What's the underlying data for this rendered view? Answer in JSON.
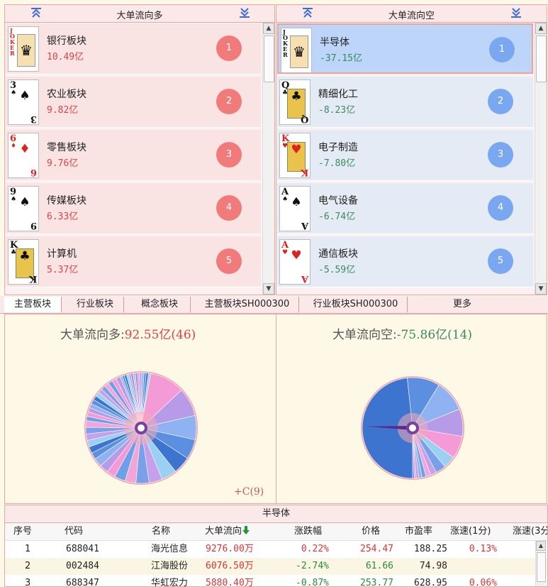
{
  "left_panel": {
    "title": "大单流向多",
    "items": [
      {
        "rank": "1",
        "name": "银行板块",
        "value": "10.49亿",
        "card": {
          "rank": "JOKER",
          "suit": "🃏",
          "color": "#d22",
          "face": true
        }
      },
      {
        "rank": "2",
        "name": "农业板块",
        "value": "9.82亿",
        "card": {
          "rank": "3",
          "suit": "♠",
          "color": "#111",
          "face": false
        }
      },
      {
        "rank": "3",
        "name": "零售板块",
        "value": "9.76亿",
        "card": {
          "rank": "6",
          "suit": "♦",
          "color": "#d22",
          "face": false
        }
      },
      {
        "rank": "4",
        "name": "传媒板块",
        "value": "6.33亿",
        "card": {
          "rank": "9",
          "suit": "♠",
          "color": "#111",
          "face": false
        }
      },
      {
        "rank": "5",
        "name": "计算机",
        "value": "5.37亿",
        "card": {
          "rank": "K",
          "suit": "♣",
          "color": "#111",
          "face": true
        }
      }
    ]
  },
  "right_panel": {
    "title": "大单流向空",
    "items": [
      {
        "rank": "1",
        "name": "半导体",
        "value": "-37.15亿",
        "card": {
          "rank": "JOKER",
          "suit": "🃏",
          "color": "#111",
          "face": true
        },
        "selected": true
      },
      {
        "rank": "2",
        "name": "精细化工",
        "value": "-8.23亿",
        "card": {
          "rank": "Q",
          "suit": "♣",
          "color": "#111",
          "face": true
        }
      },
      {
        "rank": "3",
        "name": "电子制造",
        "value": "-7.80亿",
        "card": {
          "rank": "K",
          "suit": "♥",
          "color": "#d22",
          "face": true
        }
      },
      {
        "rank": "4",
        "name": "电气设备",
        "value": "-6.74亿",
        "card": {
          "rank": "A",
          "suit": "♠",
          "color": "#111",
          "face": false
        }
      },
      {
        "rank": "5",
        "name": "通信板块",
        "value": "-5.59亿",
        "card": {
          "rank": "A",
          "suit": "♥",
          "color": "#d22",
          "face": false
        }
      }
    ]
  },
  "tabs": [
    "主营板块",
    "行业板块",
    "概念板块",
    "主营板块SH000300",
    "行业板块SH000300",
    "更多"
  ],
  "pies": {
    "left_label": "大单流向多:",
    "left_value": "92.55亿(46)",
    "right_label": "大单流向空:",
    "right_value": "-75.86亿(14)",
    "corner_note": "+C(9)"
  },
  "table": {
    "caption": "半导体",
    "headers": [
      "序号",
      "代码",
      "名称",
      "大单流向",
      "涨跌幅",
      "价格",
      "市盈率",
      "涨速(1分)",
      "涨速(3分"
    ],
    "rows": [
      [
        "1",
        "688041",
        "海光信息",
        "9276.00万",
        "0.22%",
        "254.47",
        "188.25",
        "0.13%",
        ""
      ],
      [
        "2",
        "002484",
        "江海股份",
        "6076.50万",
        "-2.74%",
        "61.66",
        "74.98",
        "",
        ""
      ],
      [
        "3",
        "688347",
        "华虹宏力",
        "5880.40万",
        "-0.87%",
        "253.77",
        "628.95",
        "0.06%",
        "-"
      ]
    ]
  },
  "colors": {
    "accent_red": "#f17b7b",
    "accent_blue": "#7aa8f0",
    "selected": "#bcd5f8"
  }
}
